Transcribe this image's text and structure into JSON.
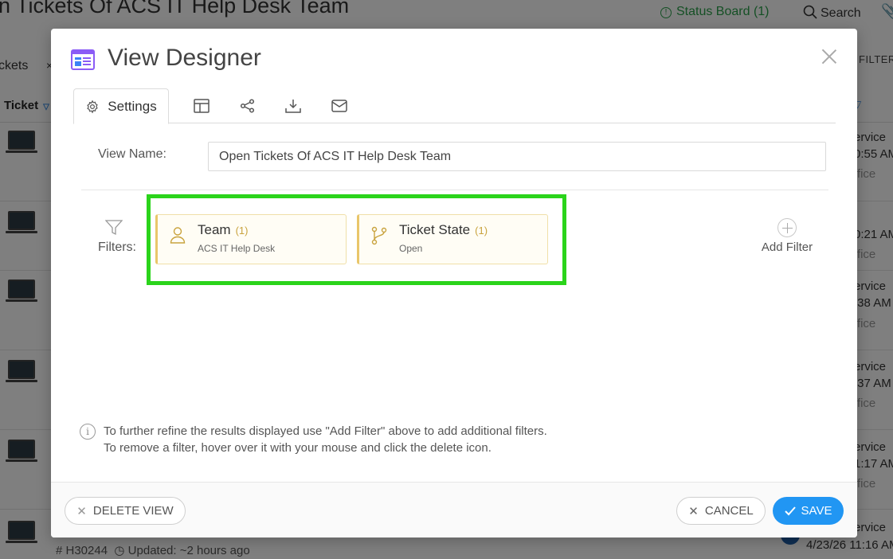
{
  "background": {
    "page_title": "n Tickets Of ACS IT Help Desk Team",
    "status_board": "Status Board (1)",
    "search": "Search",
    "tickets_tab": "ckets",
    "filter_label": "FILTER",
    "column_ticket": "Ticket",
    "rows": [
      {
        "line1": "ervice",
        "line2": "0:55 AM",
        "line3": "ffice"
      },
      {
        "line1": "",
        "line2": "0:21 AM",
        "line3": "ffice"
      },
      {
        "line1": "ervice",
        "line2": ":38 AM",
        "line3": "ffice"
      },
      {
        "line1": "ervice",
        "line2": ":37 AM",
        "line3": "ffice"
      },
      {
        "line1": "ervice",
        "line2": "1:17 AM",
        "line3": "ffice"
      },
      {
        "line1": "ervice",
        "line2": "",
        "line3": ""
      }
    ],
    "bottom_ticket_id": "# H30244",
    "bottom_updated": "Updated: ~2 hours ago",
    "bottom_date": "4/23/26 11:16 AM"
  },
  "modal": {
    "title": "View Designer",
    "tabs": [
      {
        "label": "Settings",
        "icon": "gear-icon"
      },
      {
        "label": "",
        "icon": "columns-icon"
      },
      {
        "label": "",
        "icon": "share-icon"
      },
      {
        "label": "",
        "icon": "download-icon"
      },
      {
        "label": "",
        "icon": "email-icon"
      }
    ],
    "view_name_label": "View Name:",
    "view_name_value": "Open Tickets Of ACS IT Help Desk Team",
    "filters_label": "Filters:",
    "filters": [
      {
        "title": "Team",
        "count": "(1)",
        "value": "ACS IT Help Desk",
        "icon": "user-icon"
      },
      {
        "title": "Ticket State",
        "count": "(1)",
        "value": "Open",
        "icon": "branch-icon"
      }
    ],
    "add_filter_label": "Add Filter",
    "info_line1": "To further refine the results displayed use \"Add Filter\" above to add additional filters.",
    "info_line2": "To remove a filter, hover over it with your mouse and click the delete icon.",
    "footer": {
      "delete_label": "DELETE VIEW",
      "cancel_label": "CANCEL",
      "save_label": "SAVE"
    }
  },
  "colors": {
    "save_button": "#2196f3",
    "highlight": "#2bd41b",
    "chip_accent": "#e9c66a",
    "status_green": "#2aa14a"
  }
}
